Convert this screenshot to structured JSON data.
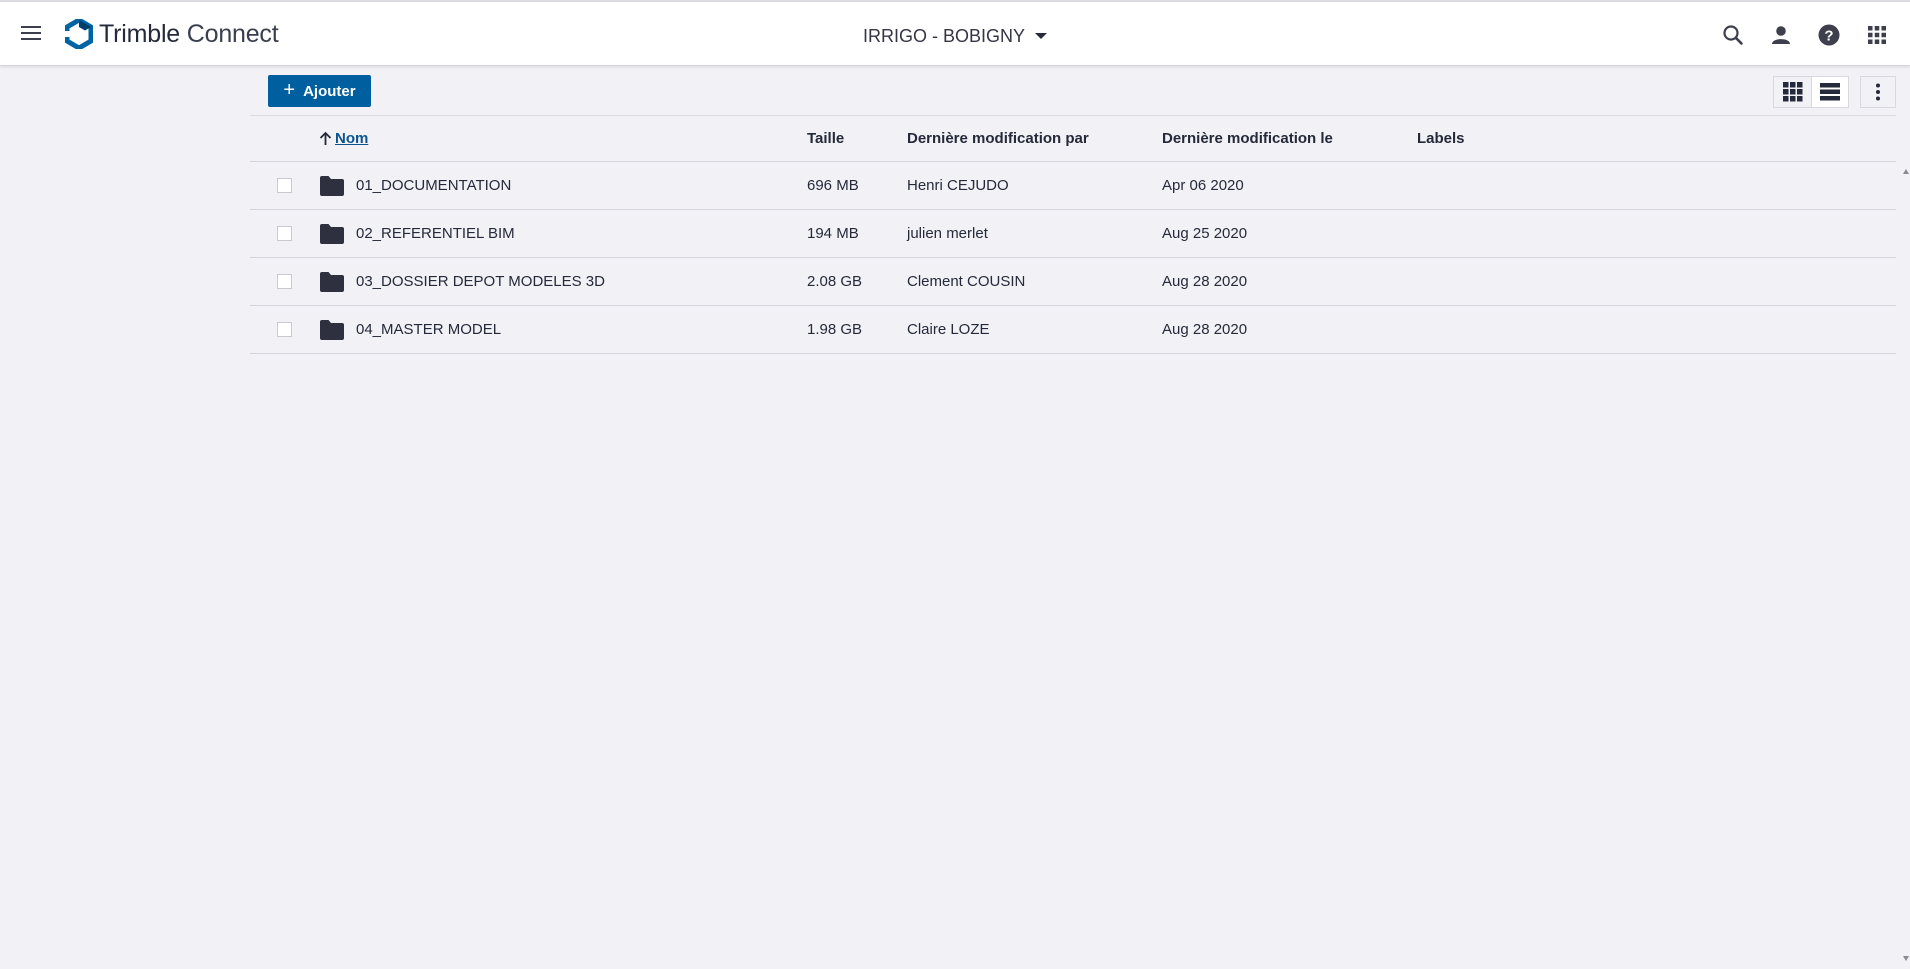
{
  "header": {
    "brand_bold": "Trimble",
    "brand_light": "Connect",
    "project_name": "IRRIGO - BOBIGNY"
  },
  "toolbar": {
    "add_label": "Ajouter"
  },
  "table": {
    "columns": {
      "name": "Nom",
      "size": "Taille",
      "modified_by": "Dernière modification par",
      "modified_on": "Dernière modification le",
      "labels": "Labels"
    },
    "rows": [
      {
        "name": "01_DOCUMENTATION",
        "size": "696 MB",
        "modified_by": "Henri CEJUDO",
        "modified_on": "Apr 06 2020",
        "labels": ""
      },
      {
        "name": "02_REFERENTIEL BIM",
        "size": "194 MB",
        "modified_by": "julien merlet",
        "modified_on": "Aug 25 2020",
        "labels": ""
      },
      {
        "name": "03_DOSSIER DEPOT MODELES 3D",
        "size": "2.08 GB",
        "modified_by": "Clement COUSIN",
        "modified_on": "Aug 28 2020",
        "labels": ""
      },
      {
        "name": "04_MASTER MODEL",
        "size": "1.98 GB",
        "modified_by": "Claire LOZE",
        "modified_on": "Aug 28 2020",
        "labels": ""
      }
    ]
  },
  "colors": {
    "accent": "#005f9e",
    "background": "#f1f1f6",
    "text": "#252a3a",
    "logo": "#0063a3"
  },
  "icons": {
    "menu": "hamburger-icon",
    "search": "search-icon",
    "user": "user-icon",
    "help": "help-icon",
    "apps": "apps-grid-icon",
    "folder": "folder-icon",
    "grid_view": "grid-view-icon",
    "list_view": "list-view-icon",
    "more": "more-vertical-icon"
  }
}
